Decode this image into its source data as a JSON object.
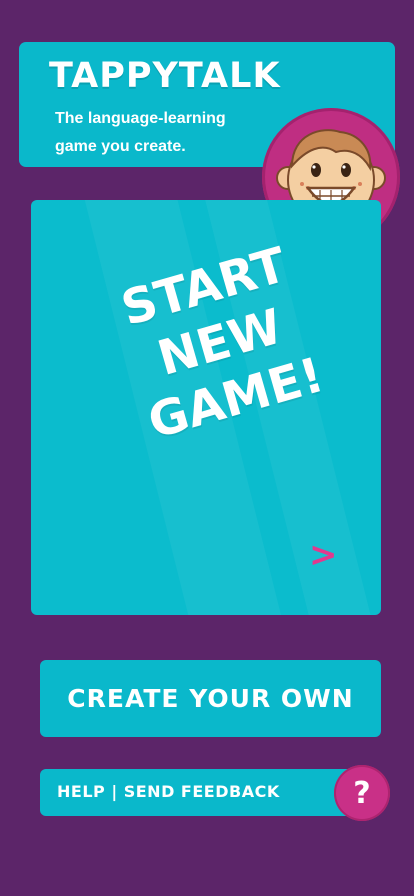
{
  "header": {
    "title": "TAPPYTALK",
    "tagline": "The language-learning game you create."
  },
  "start": {
    "line1": "START",
    "line2": "NEW",
    "line3": "GAME!",
    "arrow": ">"
  },
  "actions": {
    "create_label": "CREATE YOUR OWN",
    "help_label": "HELP | SEND FEEDBACK",
    "help_icon": "?"
  },
  "icons": {
    "avatar": "smiling-boy-face-icon"
  },
  "colors": {
    "background": "#5c2569",
    "card": "#0ab8cb",
    "accent": "#c93087"
  }
}
